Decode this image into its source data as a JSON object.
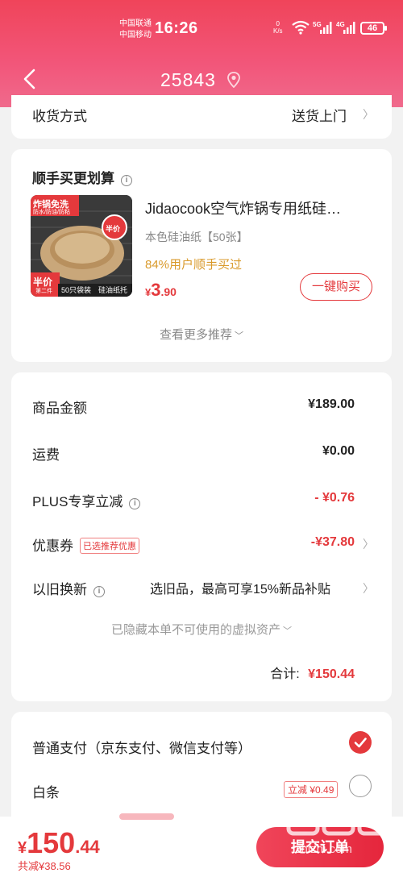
{
  "status_bar": {
    "carrier1": "中国联通",
    "carrier2": "中国移动",
    "time": "16:26",
    "net_speed_value": "0",
    "net_speed_unit": "K/s",
    "battery": "46"
  },
  "header": {
    "title": "25843"
  },
  "delivery": {
    "label": "收货方式",
    "value": "送货上门"
  },
  "recommend": {
    "title": "顺手买更划算",
    "product_name": "Jidaocook空气炸锅专用纸硅…",
    "spec": "本色硅油纸【50张】",
    "hint": "84%用户顺手买过",
    "price_symbol": "¥",
    "price_int": "3",
    "price_dec": ".90",
    "buy_button": "一键购买",
    "more": "查看更多推荐",
    "thumb": {
      "banner": "炸锅免洗",
      "sub": "防水/防油/防粘",
      "badge_top": "半价",
      "badge_bottom": "半价",
      "badge_bottom_sub": "第二件",
      "pack": "50只袋装",
      "label": "硅油纸托"
    }
  },
  "summary": {
    "goods_label": "商品金额",
    "goods_value": "¥189.00",
    "shipping_label": "运费",
    "shipping_value": "¥0.00",
    "plus_label": "PLUS专享立减",
    "plus_value": "- ¥0.76",
    "coupon_label": "优惠券",
    "coupon_tag": "已选推荐优惠",
    "coupon_value": "-¥37.80",
    "tradein_label": "以旧换新",
    "tradein_value": "选旧品，最高可享15%新品补贴",
    "hidden_note": "已隐藏本单不可使用的虚拟资产",
    "total_label": "合计:",
    "total_value": "¥150.44"
  },
  "payment": {
    "option1": "普通支付（京东支付、微信支付等）",
    "option2": "白条",
    "option2_tag": "立减 ¥0.49"
  },
  "bottom": {
    "symbol": "¥",
    "amount_int": "150",
    "amount_dec": ".44",
    "saved": "共减¥38.56",
    "submit": "提交订单"
  },
  "watermark": {
    "text": "值 什么值得买",
    "site": "zhizhi.com"
  },
  "colors": {
    "accent": "#e4393c",
    "header": "#f0445a"
  }
}
